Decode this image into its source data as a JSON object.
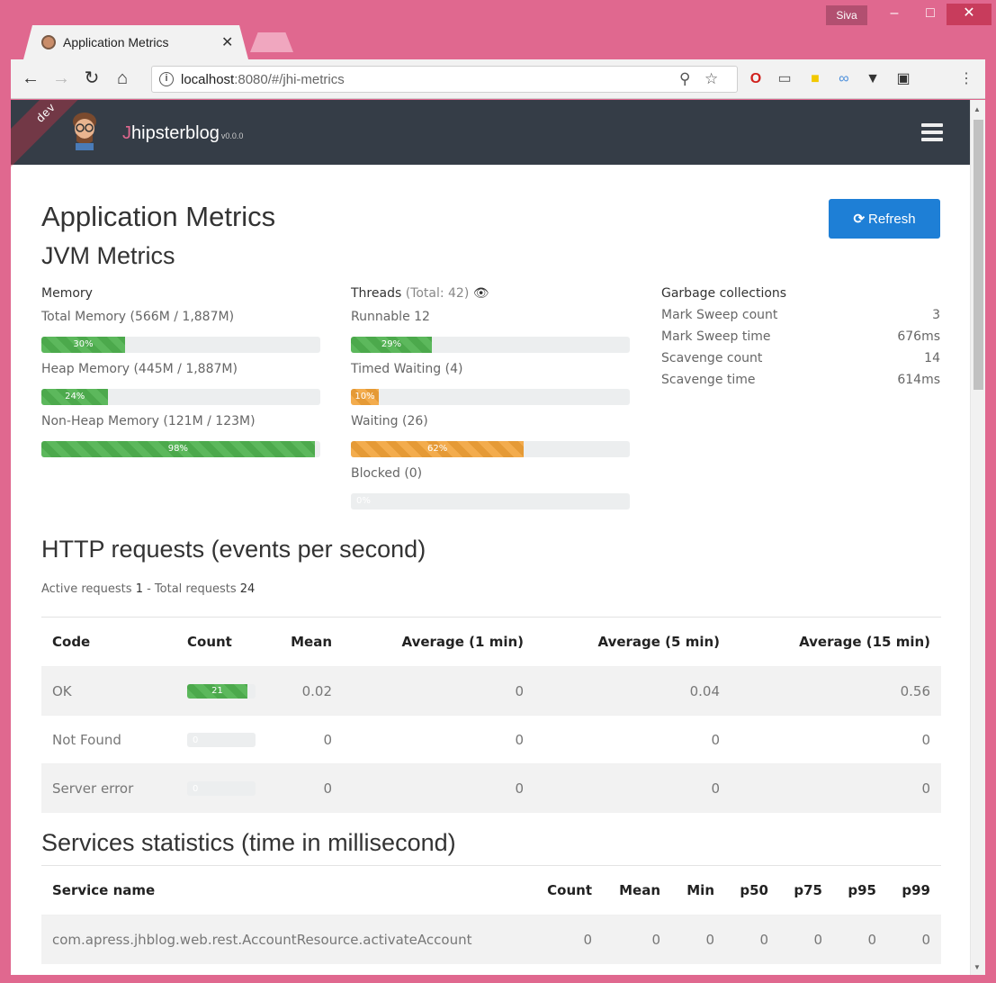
{
  "browser": {
    "user": "Siva",
    "tab_title": "Application Metrics",
    "url_host": "localhost",
    "url_rest": ":8080/#/jhi-metrics"
  },
  "navbar": {
    "brand_first": "J",
    "brand_rest": "hipsterblog",
    "version": "v0.0.0",
    "ribbon": "dev"
  },
  "page": {
    "title": "Application Metrics",
    "refresh_label": "Refresh",
    "jvm_title": "JVM Metrics"
  },
  "memory": {
    "heading": "Memory",
    "items": [
      {
        "label": "Total Memory (566M / 1,887M)",
        "percent": 30,
        "text": "30%"
      },
      {
        "label": "Heap Memory (445M / 1,887M)",
        "percent": 24,
        "text": "24%"
      },
      {
        "label": "Non-Heap Memory (121M / 123M)",
        "percent": 98,
        "text": "98%"
      }
    ]
  },
  "threads": {
    "heading": "Threads",
    "total": "(Total: 42)",
    "items": [
      {
        "label": "Runnable 12",
        "percent": 29,
        "text": "29%"
      },
      {
        "label": "Timed Waiting (4)",
        "percent": 10,
        "text": "10%"
      },
      {
        "label": "Waiting (26)",
        "percent": 62,
        "text": "62%"
      },
      {
        "label": "Blocked (0)",
        "percent": 0,
        "text": "0%"
      }
    ]
  },
  "gc": {
    "heading": "Garbage collections",
    "rows": [
      {
        "label": "Mark Sweep count",
        "value": "3"
      },
      {
        "label": "Mark Sweep time",
        "value": "676ms"
      },
      {
        "label": "Scavenge count",
        "value": "14"
      },
      {
        "label": "Scavenge time",
        "value": "614ms"
      }
    ]
  },
  "http": {
    "title": "HTTP requests (events per second)",
    "active_label": "Active requests",
    "active_value": "1",
    "total_label": "- Total requests",
    "total_value": "24",
    "headers": [
      "Code",
      "Count",
      "Mean",
      "Average (1 min)",
      "Average (5 min)",
      "Average (15 min)"
    ],
    "rows": [
      {
        "code": "OK",
        "count": "21",
        "count_percent": 88,
        "mean": "0.02",
        "avg1": "0",
        "avg5": "0.04",
        "avg15": "0.56"
      },
      {
        "code": "Not Found",
        "count": "0",
        "count_percent": 0,
        "mean": "0",
        "avg1": "0",
        "avg5": "0",
        "avg15": "0"
      },
      {
        "code": "Server error",
        "count": "0",
        "count_percent": 0,
        "mean": "0",
        "avg1": "0",
        "avg5": "0",
        "avg15": "0"
      }
    ]
  },
  "services": {
    "title": "Services statistics (time in millisecond)",
    "headers": [
      "Service name",
      "Count",
      "Mean",
      "Min",
      "p50",
      "p75",
      "p95",
      "p99"
    ],
    "rows": [
      {
        "name": "com.apress.jhblog.web.rest.AccountResource.activateAccount",
        "count": "0",
        "mean": "0",
        "min": "0",
        "p50": "0",
        "p75": "0",
        "p95": "0",
        "p99": "0"
      }
    ]
  },
  "colors": {
    "accent": "#1e7fd6",
    "navbar": "#353d47",
    "success": "#5cb85c",
    "warning": "#f3ac4d",
    "frame": "#e0688f"
  }
}
